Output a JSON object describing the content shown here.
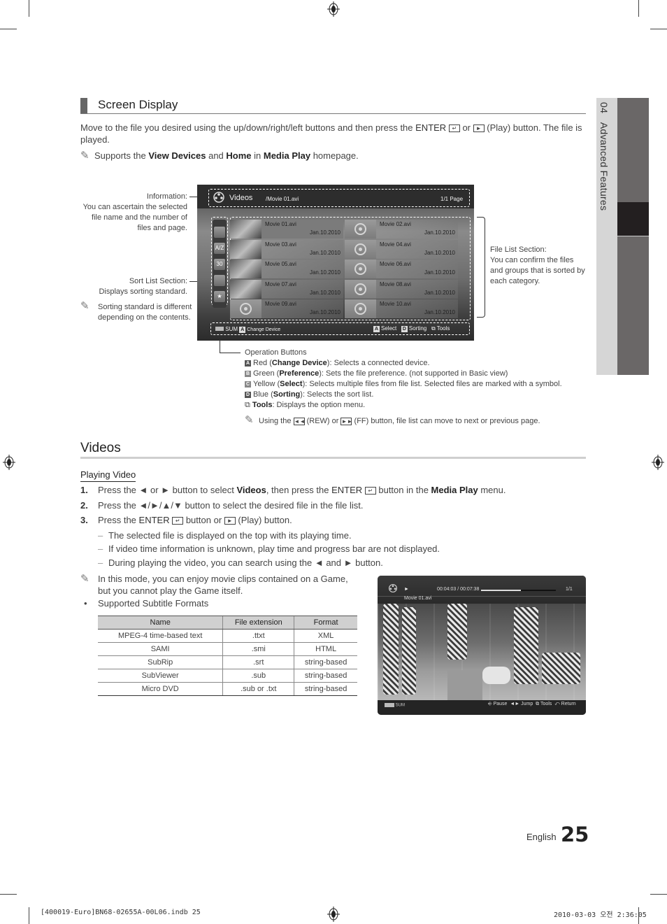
{
  "side_tab": {
    "chapter": "04",
    "title": "Advanced Features"
  },
  "screen_display": {
    "heading": "Screen Display",
    "intro_part1": "Move to the file you desired using the up/down/right/left buttons and then press the ",
    "intro_enter": "ENTER",
    "intro_part2": " or ",
    "intro_part3": " (Play) button. The file is played.",
    "note_prefix": "Supports the ",
    "note_b1": "View Devices",
    "note_mid1": " and ",
    "note_b2": "Home",
    "note_mid2": " in ",
    "note_b3": "Media Play",
    "note_suffix": " homepage."
  },
  "tv_file_list": {
    "category": "Videos",
    "path": "/Movie 01.avi",
    "page": "1/1 Page",
    "files": [
      {
        "name": "Movie 01.avi",
        "date": "Jan.10.2010",
        "thumb": "photo",
        "selected": true
      },
      {
        "name": "Movie 02.avi",
        "date": "Jan.10.2010",
        "thumb": "reel",
        "selected": false
      },
      {
        "name": "Movie 03.avi",
        "date": "Jan.10.2010",
        "thumb": "photo",
        "selected": false
      },
      {
        "name": "Movie 04.avi",
        "date": "Jan.10.2010",
        "thumb": "reel",
        "selected": false
      },
      {
        "name": "Movie 05.avi",
        "date": "Jan.10.2010",
        "thumb": "photo",
        "selected": false
      },
      {
        "name": "Movie 06.avi",
        "date": "Jan.10.2010",
        "thumb": "reel",
        "selected": false
      },
      {
        "name": "Movie 07.avi",
        "date": "Jan.10.2010",
        "thumb": "photo",
        "selected": false
      },
      {
        "name": "Movie 08.avi",
        "date": "Jan.10.2010",
        "thumb": "reel",
        "selected": false
      },
      {
        "name": "Movie 09.avi",
        "date": "Jan.10.2010",
        "thumb": "reel",
        "selected": false
      },
      {
        "name": "Movie 10.avi",
        "date": "Jan.10.2010",
        "thumb": "reel",
        "selected": false
      }
    ],
    "sort_icons": [
      "folder-icon",
      "az-sort-icon",
      "calendar-icon",
      "genre-icon",
      "favorite-star-icon"
    ],
    "sort_icon_labels": [
      "",
      "A/Z",
      "30",
      "",
      "★"
    ],
    "bottom_bar": {
      "sum": "SUM",
      "change_device_key": "A",
      "change_device": "Change Device",
      "select_key": "A",
      "select": "Select",
      "sorting_key": "D",
      "sorting": "Sorting",
      "tools": "Tools"
    }
  },
  "annotations": {
    "information_title": "Information:",
    "information_body": "You can ascertain the selected file name and the number of files and page.",
    "sort_title": "Sort List Section:",
    "sort_body": "Displays sorting standard.",
    "sort_note": "Sorting standard is different depending on the contents.",
    "file_list_title": "File List Section:",
    "file_list_body": "You can confirm the files and groups that is sorted by each category."
  },
  "operation_buttons": {
    "title": "Operation Buttons",
    "items": [
      {
        "key": "A",
        "color": "Red",
        "name": "Change Device",
        "desc": ": Selects a connected device."
      },
      {
        "key": "B",
        "color": "Green",
        "name": "Preference",
        "desc": ": Sets the file preference. (not supported in Basic view)"
      },
      {
        "key": "C",
        "color": "Yellow",
        "name": "Select",
        "desc": ": Selects multiple files from file list. Selected files are marked with a symbol."
      },
      {
        "key": "D",
        "color": "Blue",
        "name": "Sorting",
        "desc": ": Selects the sort list."
      }
    ],
    "tools_name": "Tools",
    "tools_desc": ": Displays the option menu.",
    "note_p1": "Using the ",
    "note_rew": " (REW) or ",
    "note_ff": " (FF) button, file list can move to next or previous page."
  },
  "videos": {
    "heading": "Videos",
    "subheading": "Playing Video",
    "steps": [
      {
        "num": "1.",
        "parts": [
          "Press the ◄ or ► button to select ",
          "Videos",
          ", then press the ",
          "ENTER",
          " button in the ",
          "Media Play",
          " menu."
        ]
      },
      {
        "num": "2.",
        "text": "Press the ◄/►/▲/▼ button to select the desired file in the file list."
      },
      {
        "num": "3.",
        "parts": [
          "Press the ",
          "ENTER",
          " button or ",
          " (Play) button."
        ]
      }
    ],
    "dash_items": [
      "The selected file is displayed on the top with its playing time.",
      "If video time information is unknown, play time and progress bar are not displayed.",
      "During playing the video, you can search using the ◄ and ► button."
    ],
    "note_line1": "In this mode, you can enjoy movie clips contained on a Game,",
    "note_line2": "but you cannot play the Game itself.",
    "bullet": "Supported Subtitle Formats",
    "table": {
      "headers": [
        "Name",
        "File extension",
        "Format"
      ],
      "rows": [
        [
          "MPEG-4 time-based text",
          ".ttxt",
          "XML"
        ],
        [
          "SAMI",
          ".smi",
          "HTML"
        ],
        [
          "SubRip",
          ".srt",
          "string-based"
        ],
        [
          "SubViewer",
          ".sub",
          "string-based"
        ],
        [
          "Micro DVD",
          ".sub or .txt",
          "string-based"
        ]
      ]
    }
  },
  "tv_player": {
    "time": "00:04:03 / 00:07:38",
    "progress_fraction": 0.53,
    "count": "1/1",
    "title": "Movie 01.avi",
    "sum": "SUM",
    "controls": [
      "Pause",
      "Jump",
      "Tools",
      "Return"
    ]
  },
  "footer": {
    "language": "English",
    "page_number": "25",
    "print_file": "[400019-Euro]BN68-02655A-00L06.indb   25",
    "print_date": "2010-03-03   오전 2:36:05"
  }
}
